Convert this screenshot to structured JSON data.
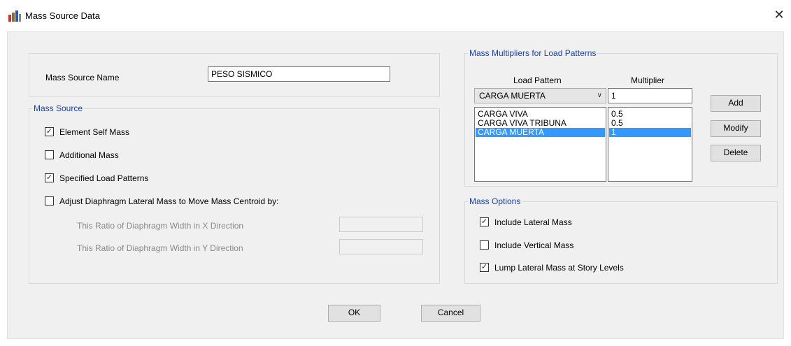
{
  "window": {
    "title": "Mass Source Data",
    "close_glyph": "✕",
    "icon": "app-grid-icon"
  },
  "name_section": {
    "label": "Mass Source Name",
    "value": "PESO SISMICO"
  },
  "mass_source": {
    "legend": "Mass Source",
    "element_self_mass": {
      "label": "Element Self Mass",
      "checked": true
    },
    "additional_mass": {
      "label": "Additional Mass",
      "checked": false
    },
    "specified_load_patterns": {
      "label": "Specified Load Patterns",
      "checked": true
    },
    "adjust_diaphragm": {
      "label": "Adjust Diaphragm Lateral Mass to Move Mass Centroid by:",
      "checked": false
    },
    "ratio_x_label": "This Ratio of Diaphragm Width in X Direction",
    "ratio_y_label": "This Ratio of Diaphragm Width in Y Direction",
    "ratio_x_value": "",
    "ratio_y_value": ""
  },
  "multipliers": {
    "legend": "Mass Multipliers for Load Patterns",
    "col_load_pattern": "Load Pattern",
    "col_multiplier": "Multiplier",
    "selected_pattern": "CARGA MUERTA",
    "multiplier_value": "1",
    "rows": [
      {
        "pattern": "CARGA VIVA",
        "multiplier": "0.5",
        "selected": false
      },
      {
        "pattern": "CARGA VIVA TRIBUNA",
        "multiplier": "0.5",
        "selected": false
      },
      {
        "pattern": "CARGA MUERTA",
        "multiplier": "1",
        "selected": true
      }
    ],
    "add_label": "Add",
    "modify_label": "Modify",
    "delete_label": "Delete"
  },
  "mass_options": {
    "legend": "Mass Options",
    "include_lateral": {
      "label": "Include Lateral Mass",
      "checked": true
    },
    "include_vertical": {
      "label": "Include Vertical Mass",
      "checked": false
    },
    "lump_lateral": {
      "label": "Lump Lateral Mass at Story Levels",
      "checked": true
    }
  },
  "footer": {
    "ok_label": "OK",
    "cancel_label": "Cancel"
  },
  "colors": {
    "legend": "#1a3fa8",
    "selection": "#3399ff",
    "dialog_bg": "#f0f0f0"
  }
}
